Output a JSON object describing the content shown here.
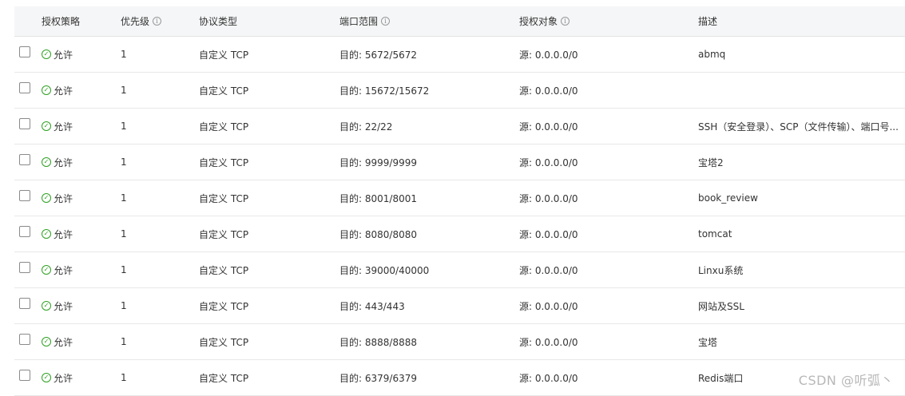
{
  "table": {
    "headers": {
      "policy": "授权策略",
      "priority": "优先级",
      "protocol": "协议类型",
      "port": "端口范围",
      "target": "授权对象",
      "description": "描述"
    },
    "rows": [
      {
        "policy": "允许",
        "priority": "1",
        "protocol": "自定义 TCP",
        "port": "目的: 5672/5672",
        "target": "源: 0.0.0.0/0",
        "description": "abmq"
      },
      {
        "policy": "允许",
        "priority": "1",
        "protocol": "自定义 TCP",
        "port": "目的: 15672/15672",
        "target": "源: 0.0.0.0/0",
        "description": ""
      },
      {
        "policy": "允许",
        "priority": "1",
        "protocol": "自定义 TCP",
        "port": "目的: 22/22",
        "target": "源: 0.0.0.0/0",
        "description": "SSH（安全登录）、SCP（文件传输）、端口号..."
      },
      {
        "policy": "允许",
        "priority": "1",
        "protocol": "自定义 TCP",
        "port": "目的: 9999/9999",
        "target": "源: 0.0.0.0/0",
        "description": "宝塔2"
      },
      {
        "policy": "允许",
        "priority": "1",
        "protocol": "自定义 TCP",
        "port": "目的: 8001/8001",
        "target": "源: 0.0.0.0/0",
        "description": "book_review"
      },
      {
        "policy": "允许",
        "priority": "1",
        "protocol": "自定义 TCP",
        "port": "目的: 8080/8080",
        "target": "源: 0.0.0.0/0",
        "description": "tomcat"
      },
      {
        "policy": "允许",
        "priority": "1",
        "protocol": "自定义 TCP",
        "port": "目的: 39000/40000",
        "target": "源: 0.0.0.0/0",
        "description": "Linxu系统"
      },
      {
        "policy": "允许",
        "priority": "1",
        "protocol": "自定义 TCP",
        "port": "目的: 443/443",
        "target": "源: 0.0.0.0/0",
        "description": "网站及SSL"
      },
      {
        "policy": "允许",
        "priority": "1",
        "protocol": "自定义 TCP",
        "port": "目的: 8888/8888",
        "target": "源: 0.0.0.0/0",
        "description": "宝塔"
      },
      {
        "policy": "允许",
        "priority": "1",
        "protocol": "自定义 TCP",
        "port": "目的: 6379/6379",
        "target": "源: 0.0.0.0/0",
        "description": "Redis端口"
      }
    ]
  },
  "watermark": "CSDN @听弧丶",
  "colors": {
    "allow_green": "#2ea121",
    "header_bg": "#f5f6f7",
    "row_border": "#e8e8e8"
  },
  "icons": {
    "info": "info-circle-icon",
    "allow": "check-circle-icon"
  }
}
